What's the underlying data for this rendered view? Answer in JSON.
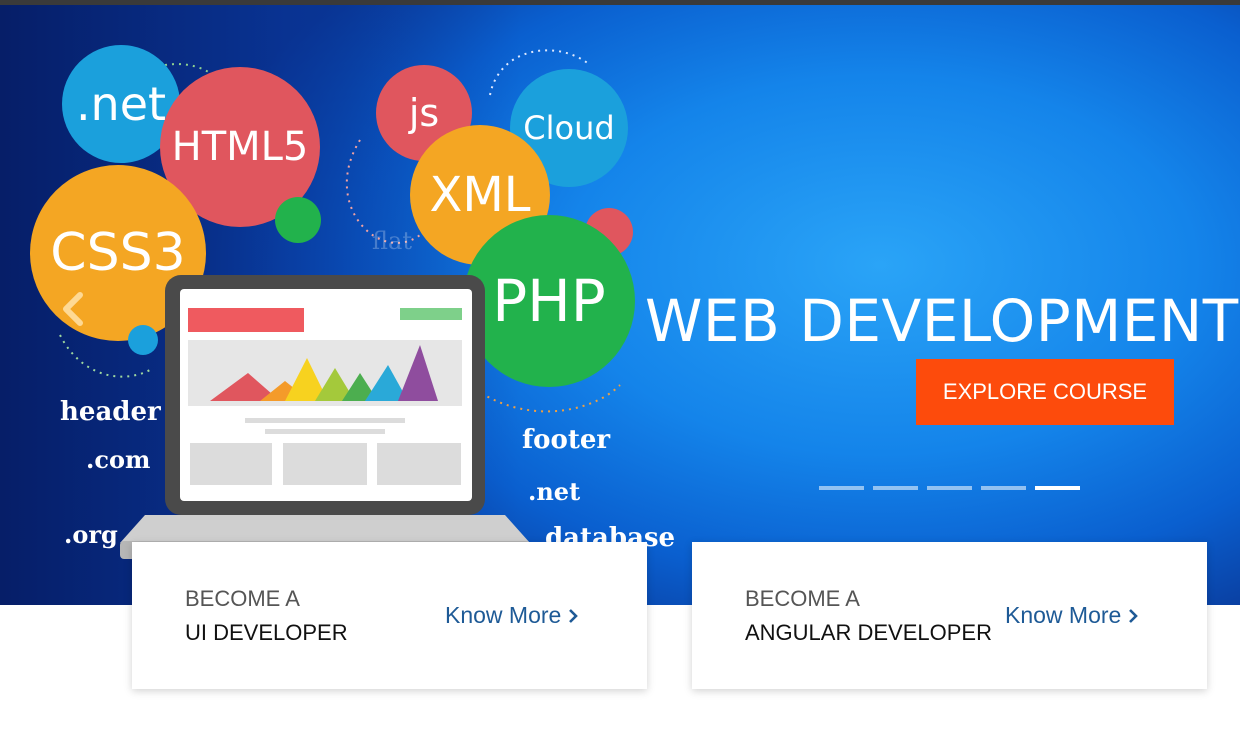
{
  "hero": {
    "title": "WEB DEVELOPMENT C",
    "cta_label": "EXPLORE COURSE",
    "slide_count": 5,
    "active_slide": 5,
    "bubbles": {
      "net": ".net",
      "html5": "HTML5",
      "css3": "CSS3",
      "js": "js",
      "cloud": "Cloud",
      "xml": "XML",
      "php": "PHP",
      "flat": "flat"
    },
    "words": {
      "header": "header",
      "com": ".com",
      "org": ".org",
      "footer": "footer",
      "net2": ".net",
      "database": "database"
    },
    "prev_icon": "chevron-left-icon",
    "colors": {
      "cta": "#fd4b0c",
      "link": "#1e5a96"
    }
  },
  "cards": [
    {
      "sub": "BECOME A",
      "title": "UI DEVELOPER",
      "link": "Know More",
      "link_icon": "chevron-right-icon"
    },
    {
      "sub": "BECOME A",
      "title": "ANGULAR DEVELOPER",
      "link": "Know More",
      "link_icon": "chevron-right-icon"
    }
  ]
}
